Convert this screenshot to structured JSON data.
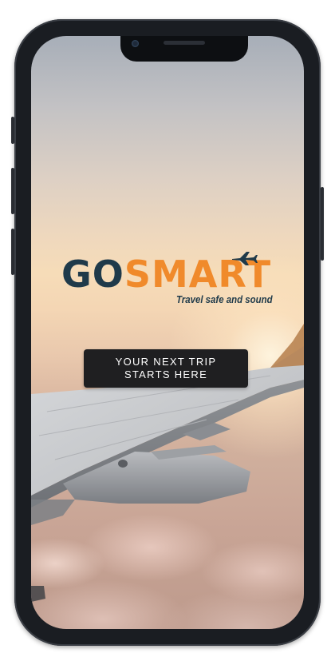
{
  "app": {
    "logo": {
      "part1": "GO",
      "part2": "SMART",
      "tagline": "Travel safe and sound",
      "colors": {
        "primary": "#1f3a4a",
        "accent": "#f08a2b"
      },
      "icon": "airplane-icon"
    },
    "cta": {
      "line1": "YOUR NEXT TRIP",
      "line2": "STARTS HERE",
      "background": "#1f1f21",
      "text_color": "#ffffff"
    },
    "background": {
      "icon": "airplane-wing-over-clouds-photo"
    }
  }
}
